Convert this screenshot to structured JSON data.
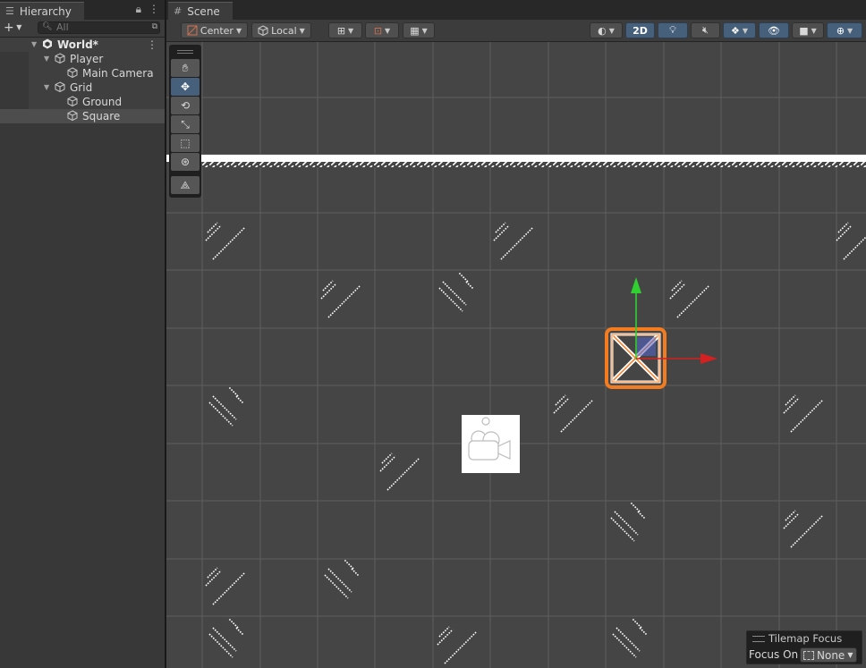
{
  "hierarchy": {
    "tab_label": "Hierarchy",
    "search_placeholder": "All",
    "add_glyph": "+",
    "scene_root": "World*",
    "items": [
      {
        "label": "Player",
        "expanded": true
      },
      {
        "label": "Main Camera"
      },
      {
        "label": "Grid",
        "expanded": true
      },
      {
        "label": "Ground"
      },
      {
        "label": "Square",
        "selected": true
      }
    ]
  },
  "scene": {
    "tab_label": "Scene",
    "pivot_mode": "Center",
    "pivot_rotation": "Local",
    "mode_2d": "2D",
    "tools": [
      "hand-tool",
      "move-tool",
      "rotate-tool",
      "scale-tool",
      "rect-tool",
      "transform-tool",
      "custom-tool"
    ],
    "active_tool": "move-tool",
    "overlay": {
      "title": "Tilemap Focus",
      "focus_label": "Focus On",
      "focus_value": "None"
    }
  },
  "colors": {
    "panel_bg": "#383838",
    "viewport_bg": "#454545",
    "grid_line": "#5e5e5e",
    "selection_orange": "#f47c20",
    "gizmo_x": "#d42020",
    "gizmo_y": "#30d030",
    "toggle_on": "#46607c"
  }
}
